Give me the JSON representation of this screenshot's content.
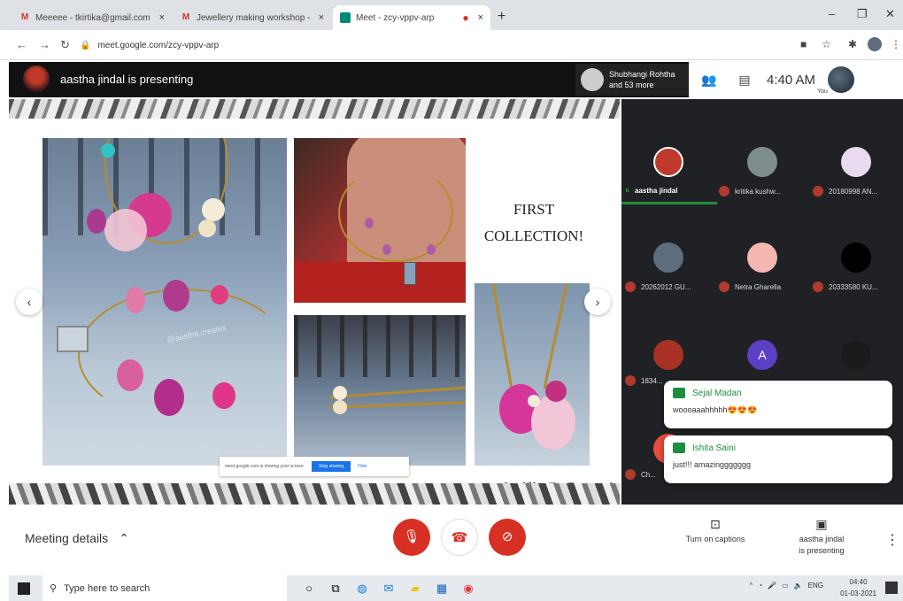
{
  "browser": {
    "tabs": [
      {
        "favicon": "gmail-icon",
        "title": "Meeeee - tkirtika@gmail.com"
      },
      {
        "favicon": "gmail-icon",
        "title": "Jewellery making workshop - ..."
      },
      {
        "favicon": "meet-icon",
        "title": "Meet - zcy-vppv-arp"
      }
    ],
    "new_tab": "+",
    "url": "meet.google.com/zcy-vppv-arp"
  },
  "meet": {
    "presenting_banner": "aastha jindal is presenting",
    "participants_chip": {
      "line1": "Shubhangi Rohtha",
      "line2": "and 53 more"
    },
    "time": "4:40 AM",
    "you_label": "You"
  },
  "slide": {
    "heading_line1": "FIRST",
    "heading_line2": "COLLECTION!",
    "watermark": "@aastha.creates",
    "share_notice": "meet.google.com is sharing your screen.",
    "stop_sharing": "Stop sharing",
    "hide": "Hide",
    "page_indicator": "1/11"
  },
  "participants": [
    {
      "name": "aastha jindal",
      "speaking": true,
      "avatar_color": "#c0392b"
    },
    {
      "name": "kritika kushw...",
      "avatar_color": "#7f8c8d"
    },
    {
      "name": "20180998 AN...",
      "avatar_color": "#e8daef"
    },
    {
      "name": "20262012 GU...",
      "avatar_color": "#5d6d7e"
    },
    {
      "name": "Netra Gharella",
      "avatar_color": "#f5b7b1"
    },
    {
      "name": "20333580 KU...",
      "avatar_color": "#000000"
    },
    {
      "name": "1834...",
      "avatar_color": "#a93226"
    },
    {
      "name": "A",
      "avatar_color": "#5b3fc4"
    },
    {
      "name": "",
      "avatar_color": "#1b1b1b"
    },
    {
      "name": "Ch...",
      "avatar_color": "#e74c3c"
    }
  ],
  "chats": [
    {
      "sender": "Sejal Madan",
      "message": "woooaaahhhhh😍😍😍"
    },
    {
      "sender": "Ishita Saini",
      "message": "just!!! amazinggggggg"
    }
  ],
  "bottom": {
    "meeting_details": "Meeting details",
    "captions": "Turn on captions",
    "presenting_line1": "aastha jindal",
    "presenting_line2": "is presenting"
  },
  "taskbar": {
    "search_placeholder": "Type here to search",
    "lang": "ENG",
    "time": "04:40",
    "date": "01-03-2021"
  }
}
